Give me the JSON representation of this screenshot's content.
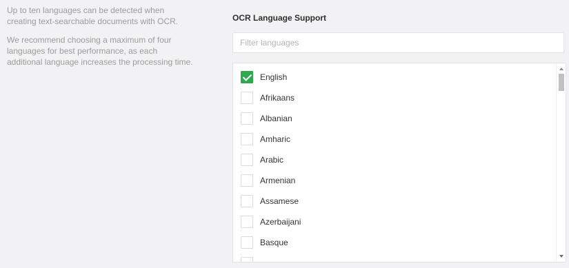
{
  "info": {
    "paragraph1": "Up to ten languages can be detected when creating text-searchable documents with OCR.",
    "paragraph2": "We recommend choosing a maximum of four languages for best performance, as each additional language increases the processing time."
  },
  "ocr": {
    "title": "OCR Language Support",
    "filter_placeholder": "Filter languages",
    "filter_value": "",
    "languages": [
      {
        "label": "English",
        "checked": true
      },
      {
        "label": "Afrikaans",
        "checked": false
      },
      {
        "label": "Albanian",
        "checked": false
      },
      {
        "label": "Amharic",
        "checked": false
      },
      {
        "label": "Arabic",
        "checked": false
      },
      {
        "label": "Armenian",
        "checked": false
      },
      {
        "label": "Assamese",
        "checked": false
      },
      {
        "label": "Azerbaijani",
        "checked": false
      },
      {
        "label": "Basque",
        "checked": false
      },
      {
        "label": "",
        "checked": false
      }
    ]
  },
  "colors": {
    "checked": "#2fa84f",
    "background": "#f2f2f4"
  },
  "icons": {
    "checkmark": "checkmark-icon",
    "scroll_up": "scroll-up-arrow-icon",
    "scroll_down": "scroll-down-arrow-icon"
  }
}
